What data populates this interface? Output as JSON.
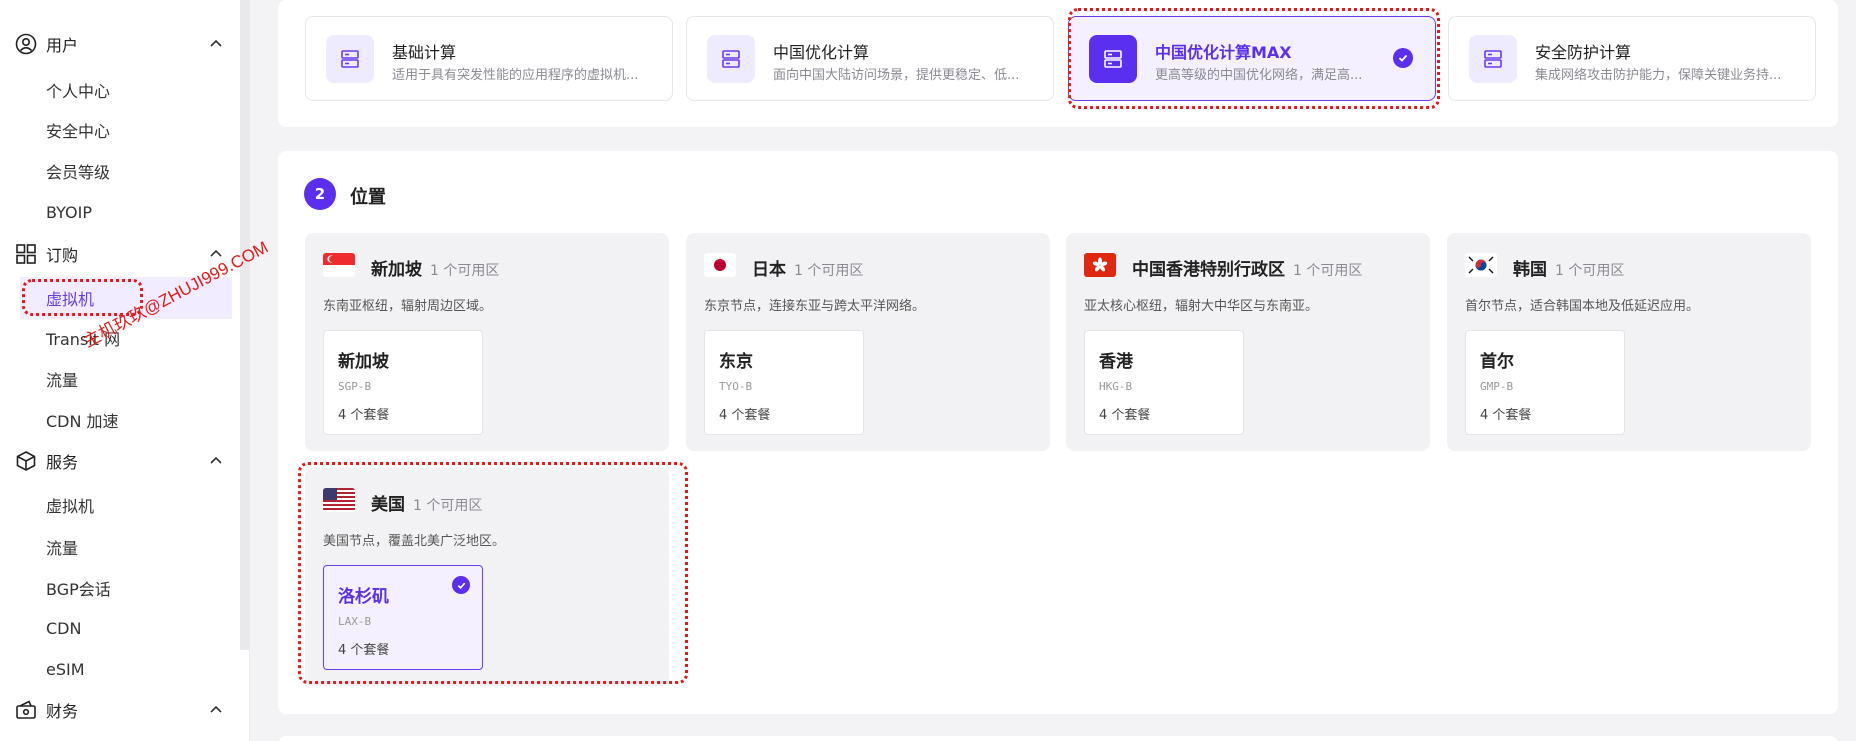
{
  "sidebar": {
    "groups": [
      {
        "title": "用户",
        "icon": "user-icon",
        "items": [
          "个人中心",
          "安全中心",
          "会员等级",
          "BYOIP"
        ]
      },
      {
        "title": "订购",
        "icon": "grid-icon",
        "items": [
          "虚拟机",
          "Transit 网",
          "流量",
          "CDN 加速"
        ]
      },
      {
        "title": "服务",
        "icon": "box-icon",
        "items": [
          "虚拟机",
          "流量",
          "BGP会话",
          "CDN",
          "eSIM"
        ]
      },
      {
        "title": "财务",
        "icon": "wallet-icon",
        "items": []
      }
    ],
    "active_item": "虚拟机"
  },
  "watermark": "主机玖玖@ZHUJI999.COM",
  "compute_types": [
    {
      "name": "基础计算",
      "desc": "适用于具有突发性能的应用程序的虚拟机...",
      "selected": false
    },
    {
      "name": "中国优化计算",
      "desc": "面向中国大陆访问场景，提供更稳定、低...",
      "selected": false
    },
    {
      "name": "中国优化计算MAX",
      "desc": "更高等级的中国优化网络，满足高...",
      "selected": true
    },
    {
      "name": "安全防护计算",
      "desc": "集成网络攻击防护能力，保障关键业务持...",
      "selected": false
    }
  ],
  "location_step": {
    "number": "2",
    "title": "位置"
  },
  "regions": [
    {
      "name": "新加坡",
      "zones": "1 个可用区",
      "desc": "东南亚枢纽，辐射周边区域。",
      "flag": "singapore-flag",
      "city": {
        "name": "新加坡",
        "code": "SGP-B",
        "plans": "4 个套餐",
        "selected": false
      }
    },
    {
      "name": "日本",
      "zones": "1 个可用区",
      "desc": "东京节点，连接东亚与跨太平洋网络。",
      "flag": "japan-flag",
      "city": {
        "name": "东京",
        "code": "TYO-B",
        "plans": "4 个套餐",
        "selected": false
      }
    },
    {
      "name": "中国香港特别行政区",
      "zones": "1 个可用区",
      "desc": "亚太核心枢纽，辐射大中华区与东南亚。",
      "flag": "hongkong-flag",
      "city": {
        "name": "香港",
        "code": "HKG-B",
        "plans": "4 个套餐",
        "selected": false
      }
    },
    {
      "name": "韩国",
      "zones": "1 个可用区",
      "desc": "首尔节点，适合韩国本地及低延迟应用。",
      "flag": "korea-flag",
      "city": {
        "name": "首尔",
        "code": "GMP-B",
        "plans": "4 个套餐",
        "selected": false
      }
    },
    {
      "name": "美国",
      "zones": "1 个可用区",
      "desc": "美国节点，覆盖北美广泛地区。",
      "flag": "usa-flag",
      "city": {
        "name": "洛杉矶",
        "code": "LAX-B",
        "plans": "4 个套餐",
        "selected": true
      }
    }
  ],
  "colors": {
    "accent": "#5b2ff0",
    "highlight": "#e01b1b"
  }
}
